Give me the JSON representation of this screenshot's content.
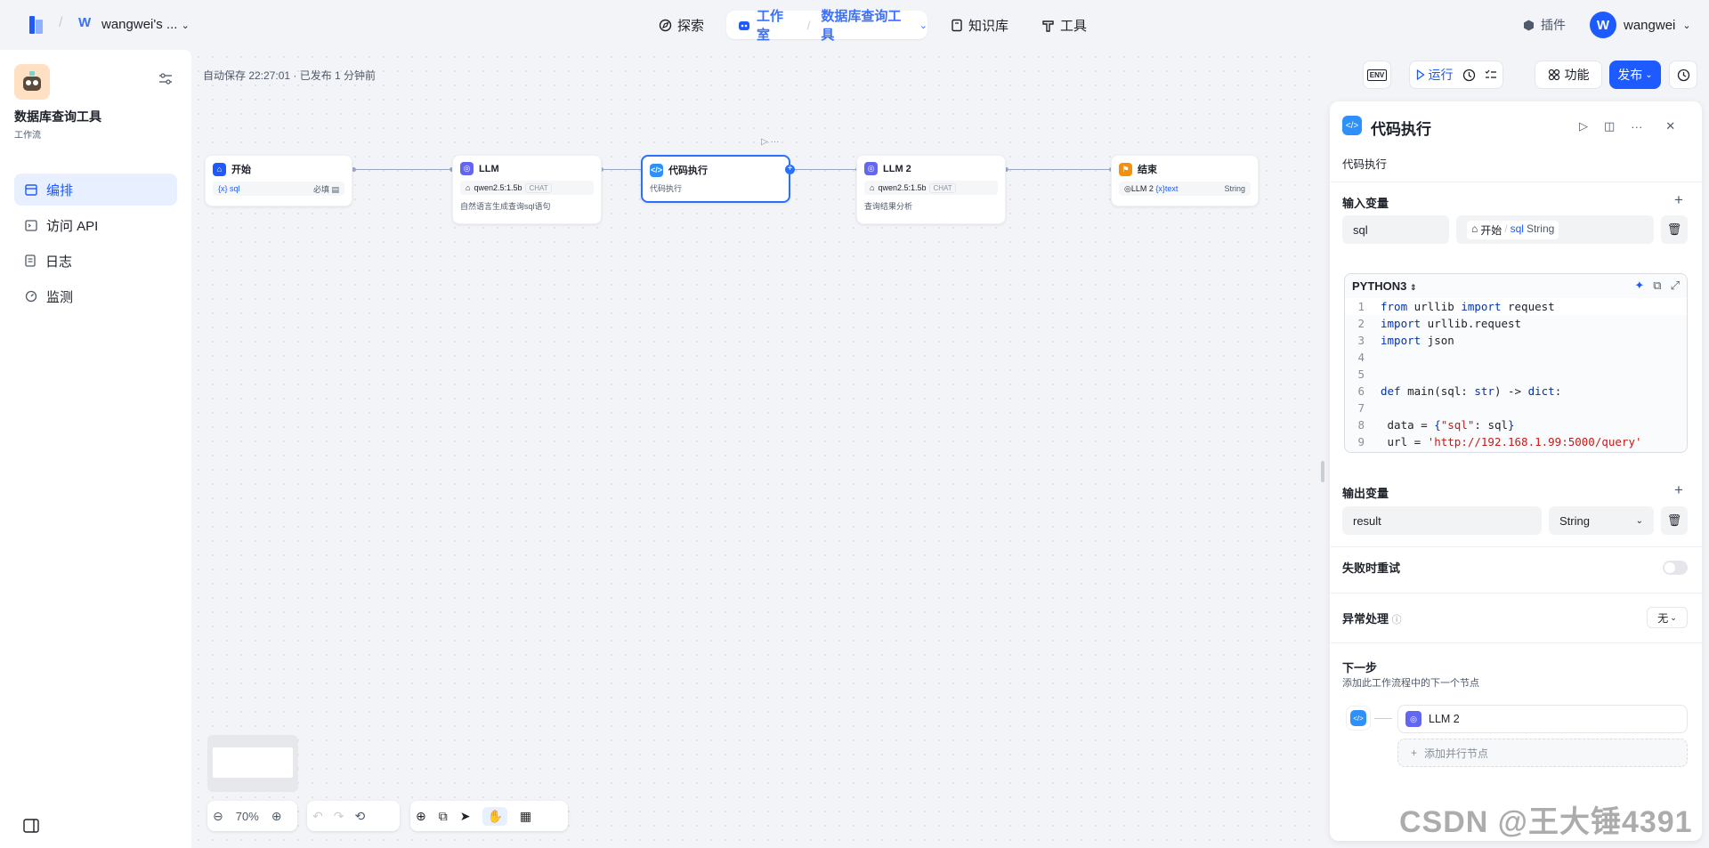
{
  "topbar": {
    "workspace_letter": "W",
    "workspace_name": "wangwei's ...",
    "nav": [
      {
        "label": "探索"
      },
      {
        "label": "工作室"
      },
      {
        "label": "知识库"
      },
      {
        "label": "工具"
      }
    ],
    "breadcrumb_app": "数据库查询工具",
    "plugins": "插件",
    "avatar": "W",
    "username": "wangwei"
  },
  "app": {
    "name": "数据库查询工具",
    "type": "工作流",
    "menu": [
      {
        "label": "编排"
      },
      {
        "label": "访问 API"
      },
      {
        "label": "日志"
      },
      {
        "label": "监测"
      }
    ]
  },
  "canvas": {
    "autosave": "自动保存 22:27:01 · 已发布 1 分钟前",
    "toolbar": {
      "env": "ENV",
      "run": "运行",
      "features": "功能",
      "publish": "发布"
    },
    "zoom": "70%",
    "nodes": {
      "start": {
        "title": "开始",
        "var": "sql",
        "required": "必填"
      },
      "llm": {
        "title": "LLM",
        "model": "qwen2.5:1.5b",
        "tag": "CHAT",
        "desc": "自然语言生成查询sql语句"
      },
      "code": {
        "title": "代码执行",
        "desc": "代码执行"
      },
      "llm2": {
        "title": "LLM 2",
        "model": "qwen2.5:1.5b",
        "tag": "CHAT",
        "desc": "查询结果分析"
      },
      "end": {
        "title": "结束",
        "src": "LLM 2",
        "var": "text",
        "type": "String"
      }
    }
  },
  "panel": {
    "title": "代码执行",
    "desc": "代码执行",
    "input_label": "输入变量",
    "input_name": "sql",
    "input_src_node": "开始",
    "input_src_var": "sql",
    "input_src_type": "String",
    "lang": "PYTHON3",
    "code_lines": [
      {
        "n": "1"
      },
      {
        "n": "2"
      },
      {
        "n": "3"
      },
      {
        "n": "4"
      },
      {
        "n": "5"
      },
      {
        "n": "6"
      },
      {
        "n": "7"
      },
      {
        "n": "8"
      },
      {
        "n": "9"
      }
    ],
    "output_label": "输出变量",
    "output_name": "result",
    "output_type": "String",
    "retry": "失败时重试",
    "error_handling": "异常处理",
    "error_value": "无",
    "next_step": "下一步",
    "next_step_desc": "添加此工作流程中的下一个节点",
    "next_node": "LLM 2",
    "add_parallel": "添加并行节点"
  },
  "watermark": "CSDN @王大锤4391"
}
